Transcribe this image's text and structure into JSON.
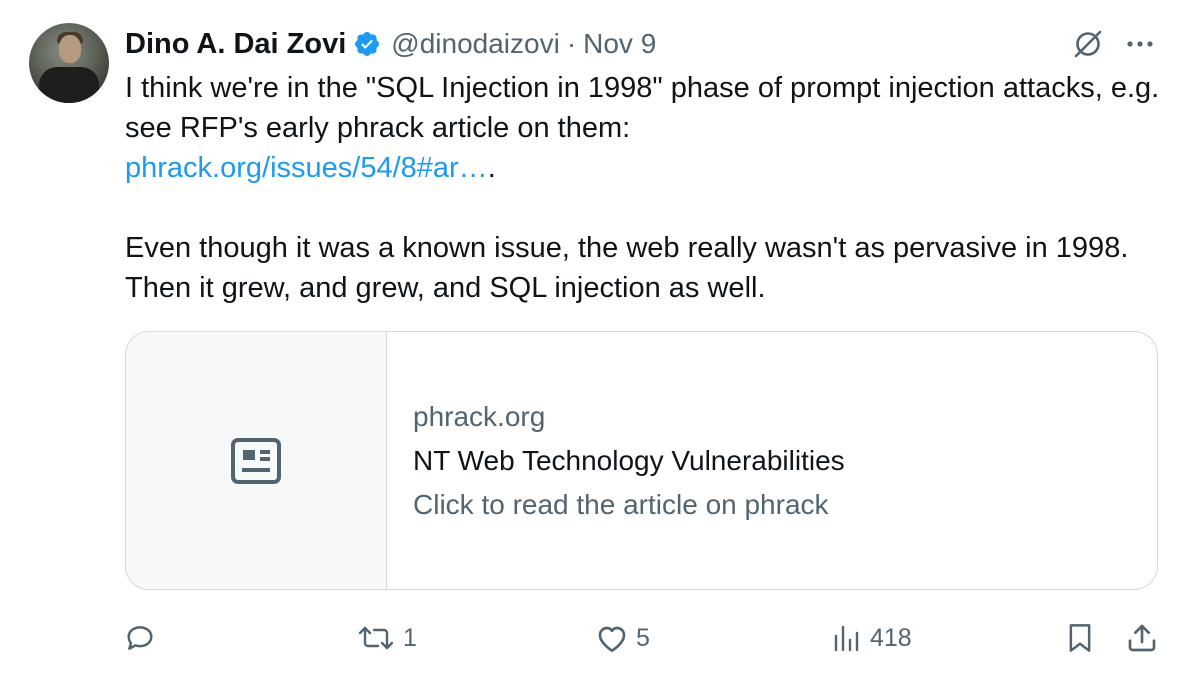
{
  "author": {
    "name": "Dino A. Dai Zovi",
    "handle": "@dinodaizovi",
    "separator": "·",
    "date": "Nov 9",
    "verified": true
  },
  "tweet": {
    "line1": "I think we're in the \"SQL Injection in 1998\" phase of prompt injection attacks, e.g. see RFP's early phrack article on them:",
    "link_text": "phrack.org/issues/54/8#ar…",
    "link_suffix": ".",
    "paragraph2": "Even though it was a known issue, the web really wasn't as pervasive in 1998. Then it grew, and grew, and SQL injection as well."
  },
  "card": {
    "domain": "phrack.org",
    "title": "NT Web Technology Vulnerabilities",
    "description": "Click to read the article on phrack",
    "thumb_icon": "article-icon"
  },
  "actions": {
    "reply": {
      "icon": "reply-icon",
      "count": ""
    },
    "retweet": {
      "icon": "retweet-icon",
      "count": "1"
    },
    "like": {
      "icon": "heart-icon",
      "count": "5"
    },
    "views": {
      "icon": "views-icon",
      "count": "418"
    },
    "bookmark": {
      "icon": "bookmark-icon"
    },
    "share": {
      "icon": "share-icon"
    }
  },
  "colors": {
    "text": "#0f1419",
    "secondary": "#536471",
    "link": "#1d9bf0",
    "verified": "#1d9bf0",
    "border": "#cfd9de",
    "card_thumb_bg": "#f7f9f9"
  }
}
